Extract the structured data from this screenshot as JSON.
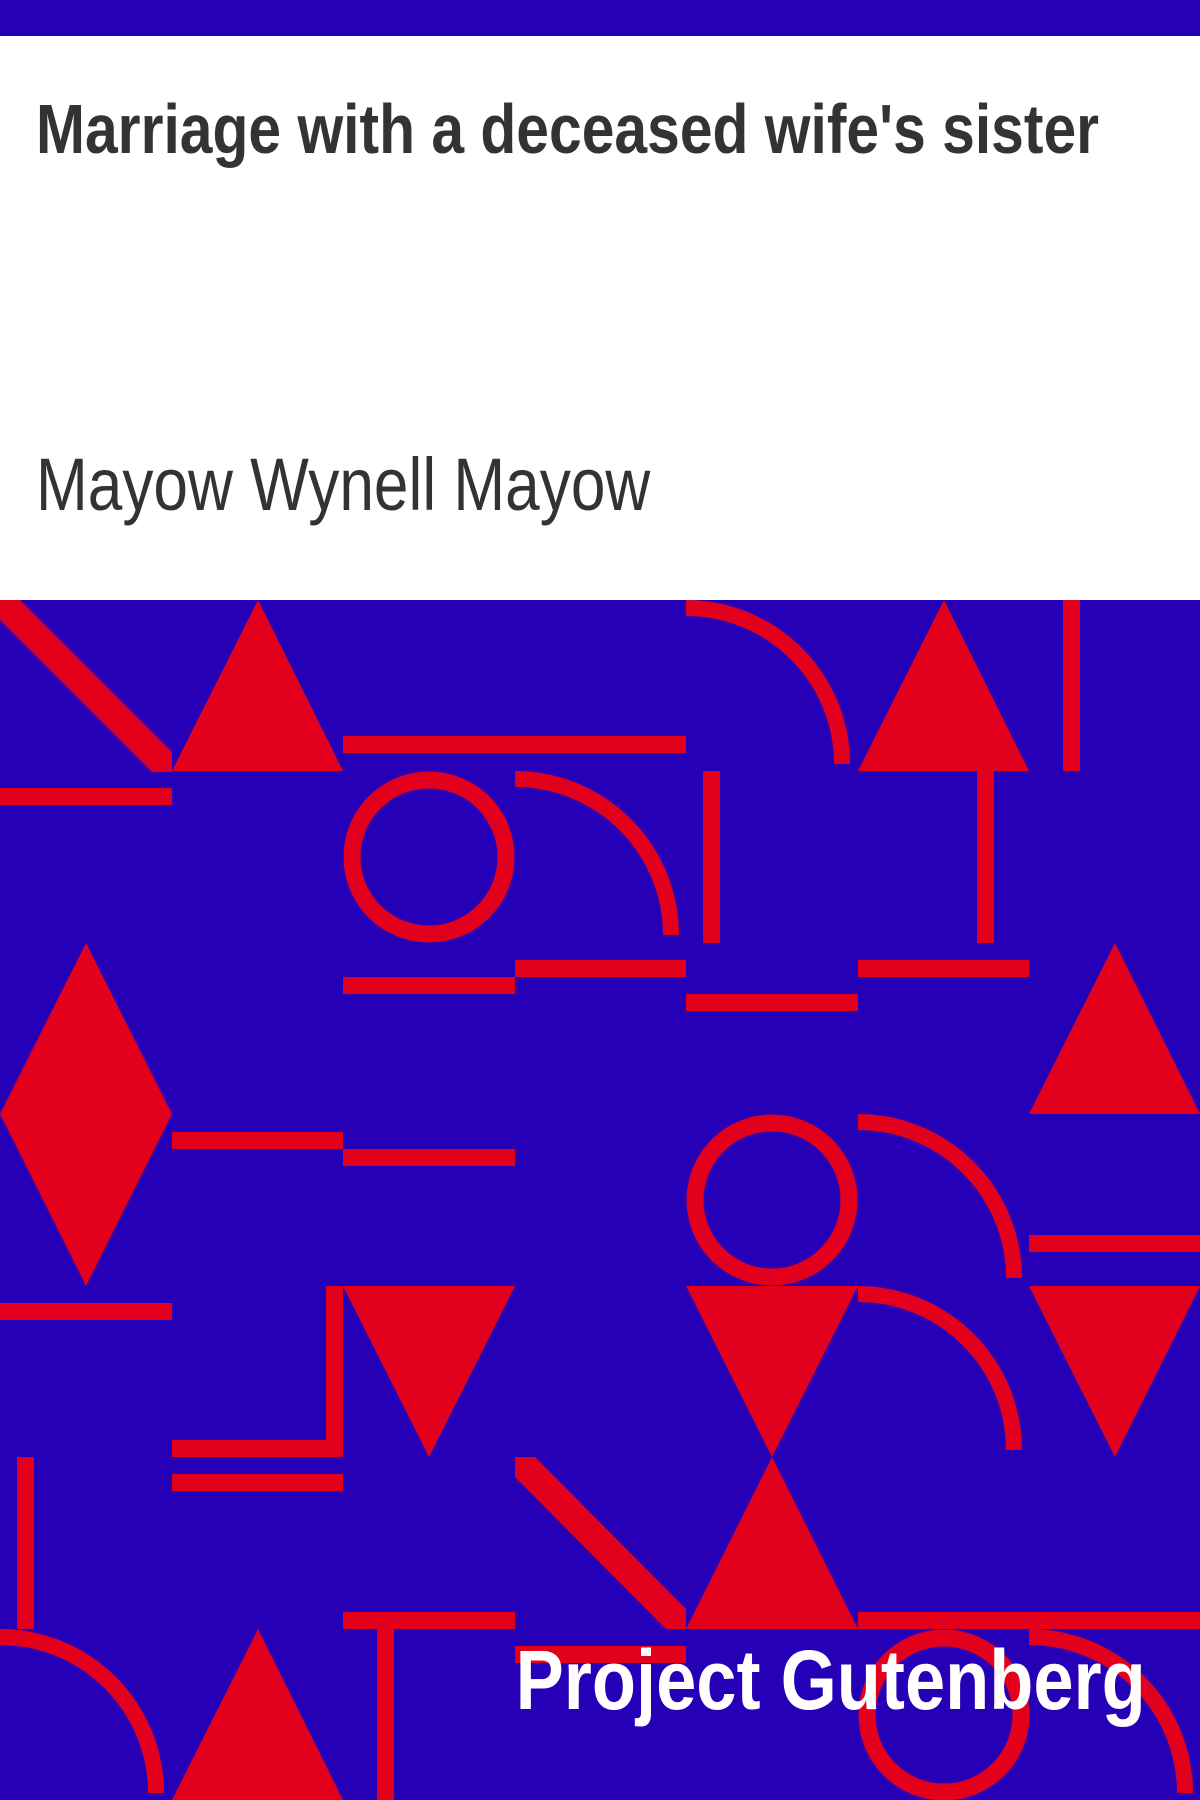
{
  "cover": {
    "title": "Marriage with a deceased wife's sister",
    "author": "Mayow Wynell Mayow",
    "publisher": "Project Gutenberg"
  },
  "colors": {
    "background": "#ffffff",
    "text": "#333333",
    "pattern_background": "#2600b6",
    "pattern_shapes": "#e3001d",
    "publisher_text": "#ffffff"
  }
}
